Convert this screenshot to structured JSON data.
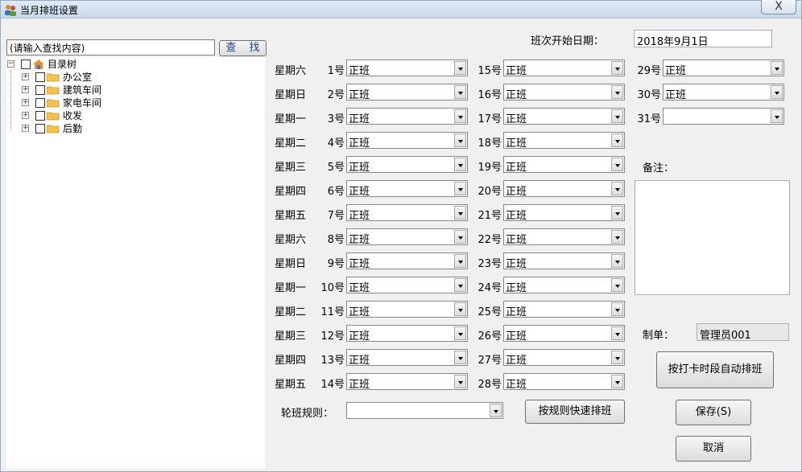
{
  "window": {
    "title": "当月排班设置",
    "close_label": "X"
  },
  "search": {
    "value": "(请输入查找内容)",
    "button_label": "查 找"
  },
  "tree": {
    "root": "目录树",
    "items": [
      "办公室",
      "建筑车间",
      "家电车间",
      "收发",
      "后勤"
    ]
  },
  "form": {
    "start_date_label": "班次开始日期：",
    "start_date_value": "2018年9月1日",
    "note_label": "备注：",
    "maker_label": "制单：",
    "maker_value": "管理员001",
    "rule_label": "轮班规则：",
    "rule_value": ""
  },
  "weekdays": [
    "星期六",
    "星期日",
    "星期一",
    "星期二",
    "星期三",
    "星期四",
    "星期五",
    "星期六",
    "星期日",
    "星期一",
    "星期二",
    "星期三",
    "星期四",
    "星期五"
  ],
  "days": [
    {
      "label": "1号",
      "value": "正班"
    },
    {
      "label": "2号",
      "value": "正班"
    },
    {
      "label": "3号",
      "value": "正班"
    },
    {
      "label": "4号",
      "value": "正班"
    },
    {
      "label": "5号",
      "value": "正班"
    },
    {
      "label": "6号",
      "value": "正班"
    },
    {
      "label": "7号",
      "value": "正班"
    },
    {
      "label": "8号",
      "value": "正班"
    },
    {
      "label": "9号",
      "value": "正班"
    },
    {
      "label": "10号",
      "value": "正班"
    },
    {
      "label": "11号",
      "value": "正班"
    },
    {
      "label": "12号",
      "value": "正班"
    },
    {
      "label": "13号",
      "value": "正班"
    },
    {
      "label": "14号",
      "value": "正班"
    },
    {
      "label": "15号",
      "value": "正班"
    },
    {
      "label": "16号",
      "value": "正班"
    },
    {
      "label": "17号",
      "value": "正班"
    },
    {
      "label": "18号",
      "value": "正班"
    },
    {
      "label": "19号",
      "value": "正班"
    },
    {
      "label": "20号",
      "value": "正班"
    },
    {
      "label": "21号",
      "value": "正班"
    },
    {
      "label": "22号",
      "value": "正班"
    },
    {
      "label": "23号",
      "value": "正班"
    },
    {
      "label": "24号",
      "value": "正班"
    },
    {
      "label": "25号",
      "value": "正班"
    },
    {
      "label": "26号",
      "value": "正班"
    },
    {
      "label": "27号",
      "value": "正班"
    },
    {
      "label": "28号",
      "value": "正班"
    },
    {
      "label": "29号",
      "value": "正班"
    },
    {
      "label": "30号",
      "value": "正班"
    },
    {
      "label": "31号",
      "value": ""
    }
  ],
  "buttons": {
    "auto_schedule": "按打卡时段自动排班",
    "quick_schedule": "按规则快速排班",
    "save": "保存(S)",
    "cancel": "取消"
  }
}
